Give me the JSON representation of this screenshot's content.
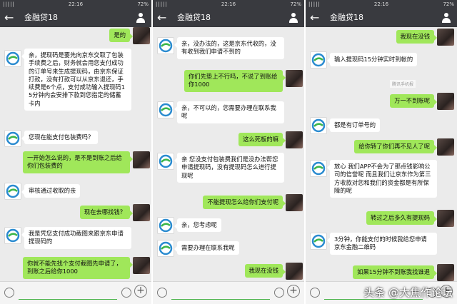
{
  "status": {
    "signal": "|||||",
    "time": "22:16",
    "battery": "72%"
  },
  "chat_title": "金融贷18",
  "back_glyph": "←",
  "plus_glyph": "+",
  "panels": [
    {
      "messages": [
        {
          "side": "right",
          "text": "是的"
        },
        {
          "side": "left",
          "text": "亲，提现码是要先向京东交取了包装手续费之后，财务就会用您支付成功的订单号来生成提现码，由京东保证打款，没有打款可以从京东退还，手续费是6个点，支付成功输入提现码15分钟内会安排下款到您指定的储蓄卡内"
        },
        {
          "side": "left",
          "text": "您现在能支付包装费吗？"
        },
        {
          "side": "right",
          "text": "一开始怎么说的，是不是到账之后给你们包装费的"
        },
        {
          "side": "left",
          "text": "审核通过收取的亲"
        },
        {
          "side": "right",
          "text": "现在去哪找钱？"
        },
        {
          "side": "left",
          "text": "我是凭您支付成功截图来跟京东申请提现码的"
        },
        {
          "side": "right",
          "text": "你就不能先找个支付截图先申请了，到账之后给你1000"
        }
      ]
    },
    {
      "messages": [
        {
          "side": "left",
          "text": "亲，没办法的，这是京东代收的，没有收到我们申请不到的"
        },
        {
          "side": "right",
          "text": "你们先垫上不行吗，不说了到账给你1000"
        },
        {
          "side": "left",
          "text": "亲，不可以的，您需要办理在联系我呢"
        },
        {
          "side": "right",
          "text": "这么死板的嘛"
        },
        {
          "side": "left",
          "text": "亲 您没支付包装费我们是没办法帮您申请提现码，没有提现码怎么进行提现呢"
        },
        {
          "side": "right",
          "text": "不能提现怎么给你们支付呢"
        },
        {
          "side": "left",
          "text": "亲，您考虑呢"
        },
        {
          "side": "left",
          "text": "需要办理在联系我呢"
        },
        {
          "side": "right",
          "text": "我现在没钱"
        }
      ]
    },
    {
      "messages": [
        {
          "side": "right",
          "text": "我现在没钱"
        },
        {
          "side": "left",
          "text": "输入提现码15分钟实时到帐的"
        },
        {
          "side": "right",
          "text": "万一不到账呢"
        },
        {
          "side": "left",
          "text": "都是有订单号的"
        },
        {
          "side": "right",
          "text": "给你转了你们再不见人了呢"
        },
        {
          "side": "left",
          "text": "放心 我们APP不会为了那点钱影响公司的信誉呢 而且我们让京东作为第三方收款对您和我们的资金都是有所保障的呢"
        },
        {
          "side": "right",
          "text": "转过之后多久有提现码"
        },
        {
          "side": "left",
          "text": "3分钟，你能支付的时候我给您申请京东金融二维码"
        },
        {
          "side": "right",
          "text": "如果15分钟不到账我找谁退"
        }
      ]
    }
  ],
  "watermark_small": "腾讯手机报",
  "footer": "头条 @大焦作论坛",
  "colors": {
    "titlebar": "#393a3f",
    "bubble_right": "#a0e75a",
    "bubble_left": "#ffffff",
    "chat_bg": "#ebebeb"
  }
}
